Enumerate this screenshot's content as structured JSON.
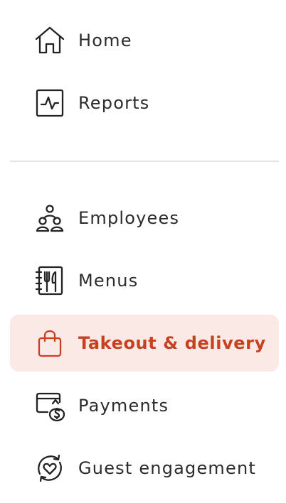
{
  "nav": {
    "items": [
      {
        "label": "Home",
        "icon": "home-icon"
      },
      {
        "label": "Reports",
        "icon": "reports-icon"
      },
      {
        "label": "Employees",
        "icon": "employees-icon"
      },
      {
        "label": "Menus",
        "icon": "menus-icon"
      },
      {
        "label": "Takeout & delivery",
        "icon": "takeout-bag-icon",
        "active": true
      },
      {
        "label": "Payments",
        "icon": "payments-icon"
      },
      {
        "label": "Guest engagement",
        "icon": "guest-engagement-icon"
      }
    ]
  },
  "colors": {
    "active_background": "#fbe9e5",
    "active_text": "#c8401f",
    "text": "#2b2b2b",
    "divider": "#e3e3e3"
  }
}
